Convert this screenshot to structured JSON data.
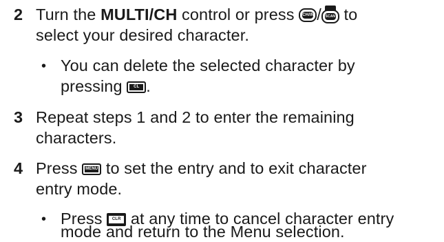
{
  "steps": [
    {
      "number": "2",
      "line1_a": "Turn the ",
      "line1_bold": "MULTI/CH",
      "line1_b": " control or press ",
      "line1_sep": "/",
      "line1_c": " to",
      "line2": "select your desired character.",
      "keys": {
        "first": "CH/IN",
        "second": "SCAN"
      },
      "bullet": {
        "line1": "You can delete the selected character by",
        "line2_a": "pressing ",
        "line2_b": ".",
        "key": "CL"
      }
    },
    {
      "number": "3",
      "line1": "Repeat steps 1 and 2 to enter the remaining",
      "line2": "characters."
    },
    {
      "number": "4",
      "line1_a": "Press ",
      "line1_b": " to set the entry and to exit character",
      "line2": "entry mode.",
      "key": "MENU",
      "bullet": {
        "line1_a": "Press ",
        "line1_b": " at any time to cancel character entry",
        "line2": "mode and return to the Menu selection.",
        "key": "CLR"
      }
    }
  ],
  "bullet_char": "•"
}
